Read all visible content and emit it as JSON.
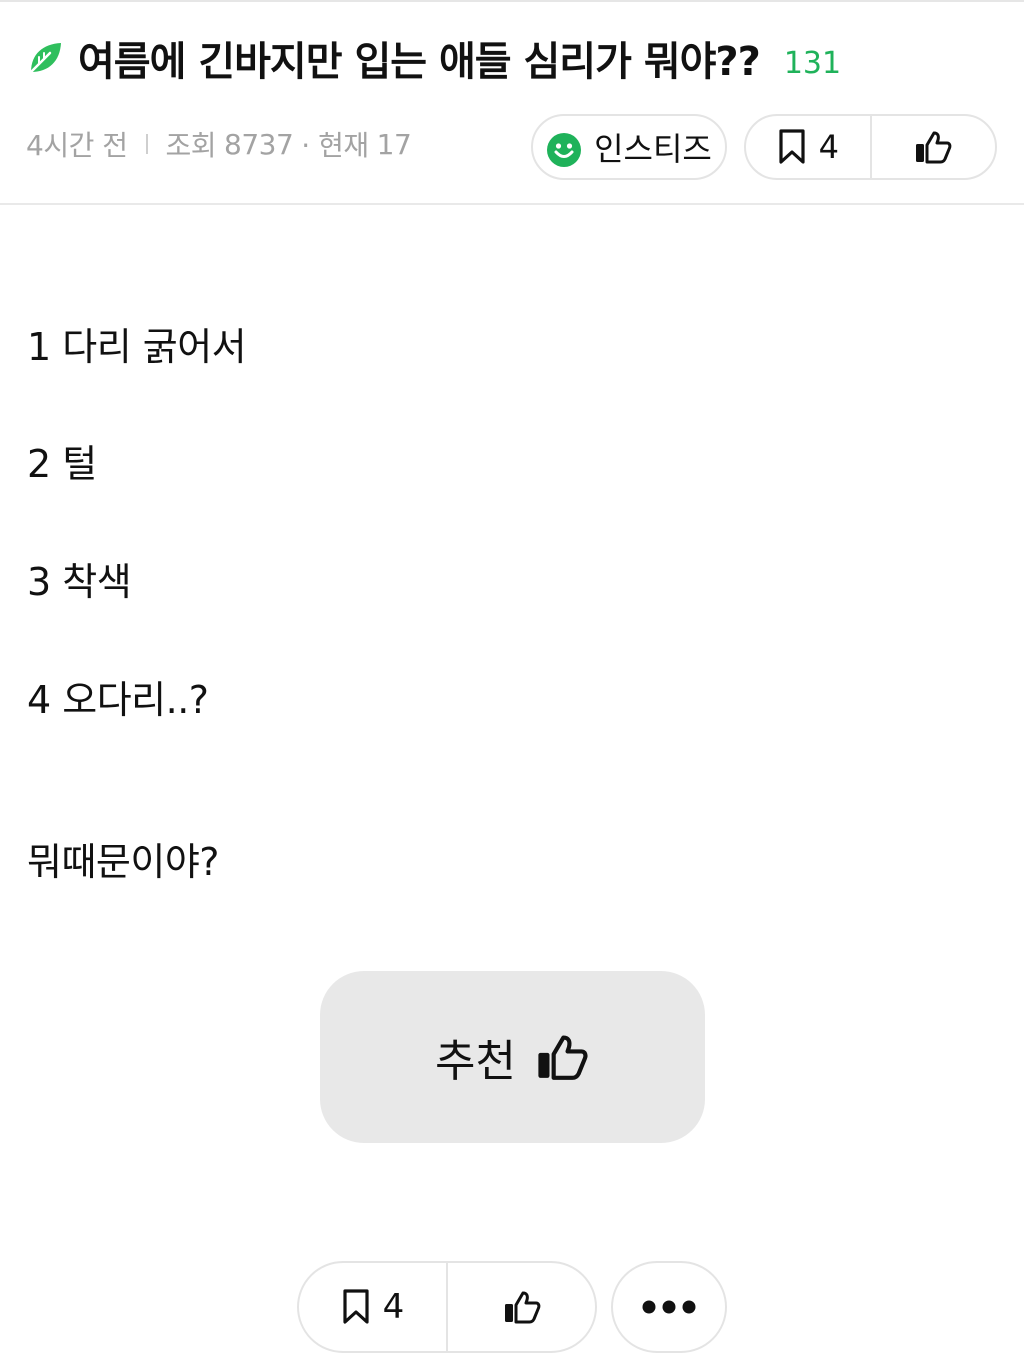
{
  "post": {
    "title": "여름에 긴바지만 입는 애들 심리가 뭐야??",
    "comment_count": "131",
    "time_ago": "4시간 전",
    "views_label": "조회",
    "views": "8737",
    "current_label": "· 현재",
    "current": "17",
    "category": "인스티즈",
    "bookmark_count": "4"
  },
  "content": {
    "lines": [
      "1 다리 굵어서",
      "2 털",
      "3 착색",
      "4 오다리..?",
      "뭐때문이야?"
    ]
  },
  "actions": {
    "recommend_label": "추천",
    "bottom_bookmark_count": "4"
  },
  "colors": {
    "accent_green": "#1fb25a",
    "meta_gray": "#a3a3a3",
    "button_gray": "#e8e8e8",
    "border": "#e4e4e4"
  },
  "icons": {
    "title_icon": "leaf-icon",
    "category_icon": "smile-icon",
    "bookmark": "bookmark-icon",
    "like": "thumbs-up-icon",
    "more": "more-dots-icon"
  }
}
